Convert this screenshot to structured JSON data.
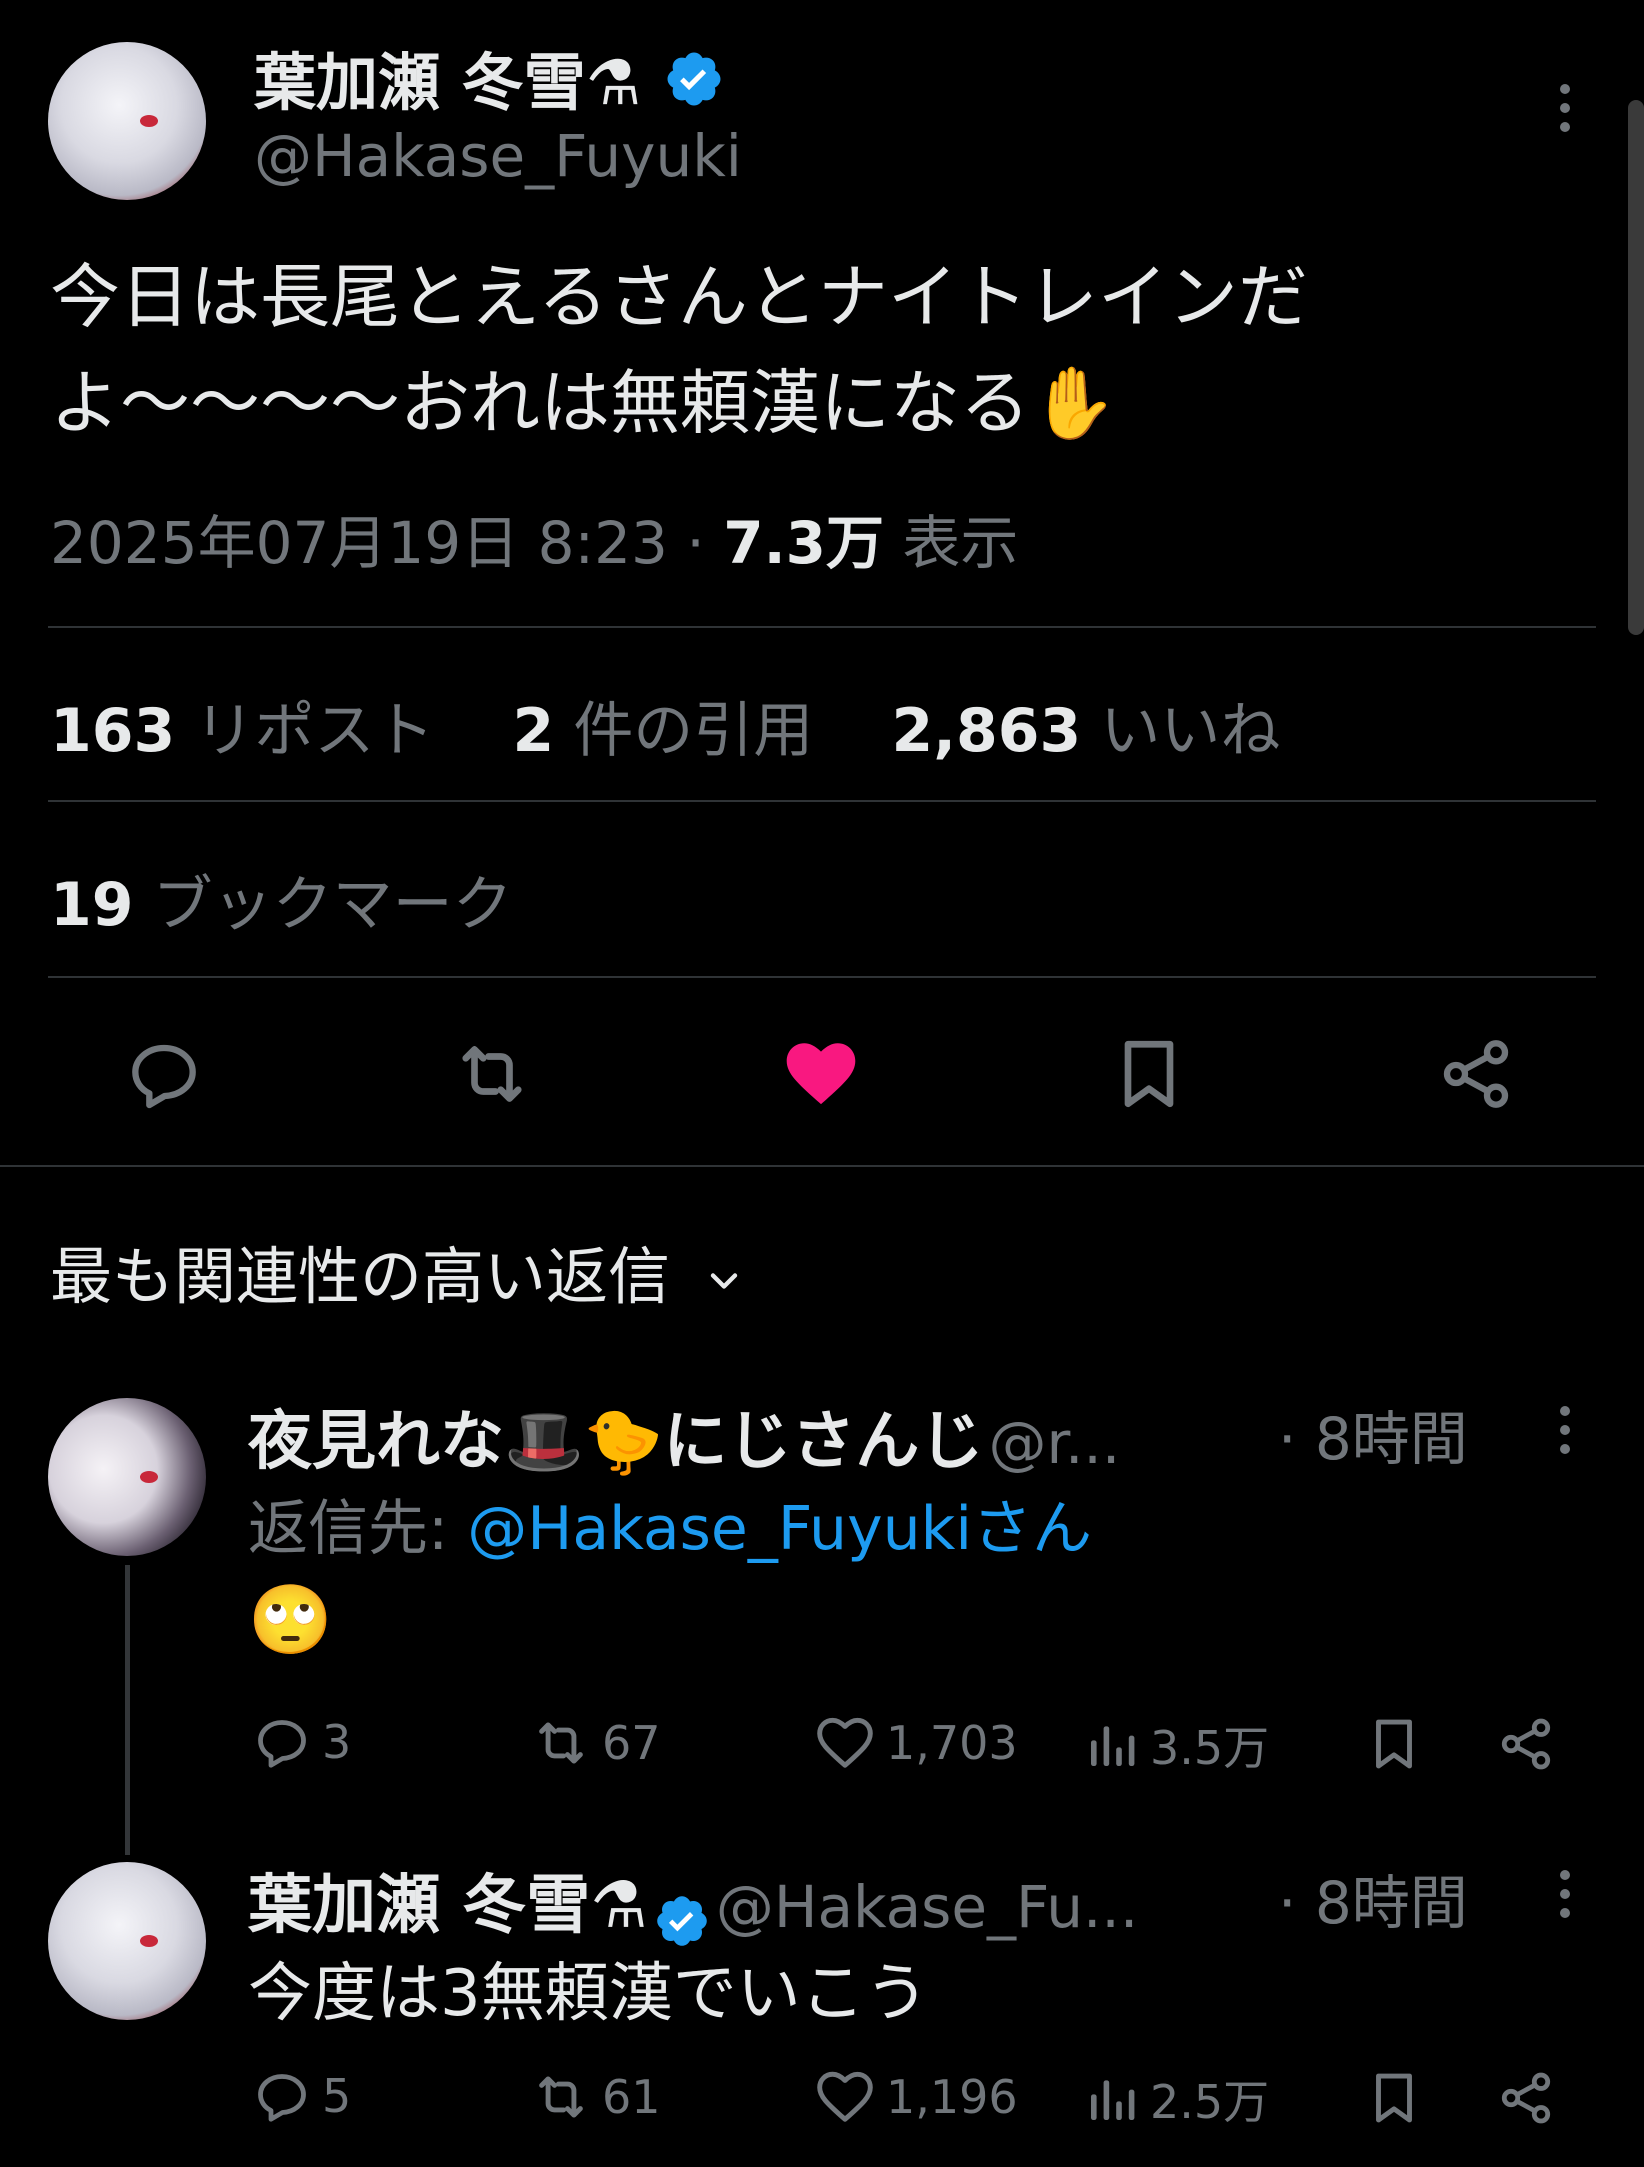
{
  "main_tweet": {
    "author_name": "葉加瀬 冬雪⚗",
    "author_handle": "@Hakase_Fuyuki",
    "text": "今日は長尾とえるさんとナイトレインだよ〜〜〜〜おれは無頼漢になる✋",
    "date": "2025年07月19日 8:23",
    "separator": "·",
    "views_count": "7.3万",
    "views_label": "表示",
    "reposts_count": "163",
    "reposts_label": "リポスト",
    "quotes_count": "2",
    "quotes_label": "件の引用",
    "likes_count": "2,863",
    "likes_label": "いいね",
    "bookmarks_count": "19",
    "bookmarks_label": "ブックマーク"
  },
  "replies_header": {
    "label": "最も関連性の高い返信"
  },
  "replies": [
    {
      "author_name": "夜見れな🎩🐤にじさんじ",
      "author_handle": "@r...",
      "time": "· 8時間",
      "reply_prefix": "返信先: ",
      "reply_target": "@Hakase_Fuyukiさん",
      "text": "🙄",
      "replies": "3",
      "reposts": "67",
      "likes": "1,703",
      "views": "3.5万"
    },
    {
      "author_name": "葉加瀬 冬雪⚗",
      "author_handle": "@Hakase_Fu...",
      "time": "· 8時間",
      "text": "今度は3無頼漢でいこう",
      "replies": "5",
      "reposts": "61",
      "likes": "1,196",
      "views": "2.5万"
    }
  ],
  "colors": {
    "background": "#000000",
    "text_primary": "#e7e9ea",
    "text_secondary": "#71767b",
    "like_active": "#f91880",
    "link": "#1d9bf0",
    "verified": "#1d9bf0",
    "divider": "#2f3336"
  },
  "icons": {
    "verified": "verified-badge-icon",
    "more": "more-dots-icon",
    "reply": "reply-icon",
    "repost": "repost-icon",
    "like": "heart-icon",
    "bookmark": "bookmark-icon",
    "share": "share-icon",
    "views": "views-icon",
    "chevron": "chevron-down-icon"
  }
}
